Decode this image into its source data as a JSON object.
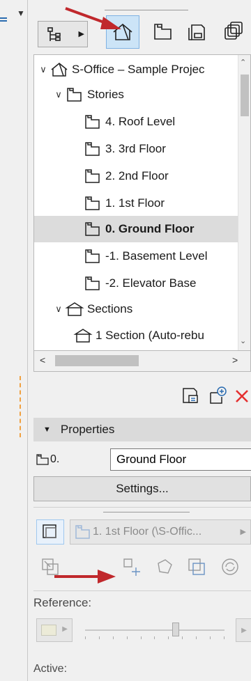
{
  "navigator": {
    "tree": {
      "project": "S-Office – Sample Projec",
      "stories_label": "Stories",
      "stories": [
        "4. Roof Level",
        "3. 3rd Floor",
        "2. 2nd Floor",
        "1. 1st Floor",
        "0. Ground Floor",
        "-1. Basement Level",
        "-2. Elevator Base"
      ],
      "selected_story": "0. Ground Floor",
      "sections_label": "Sections",
      "sections": [
        "1 Section (Auto-rebu"
      ]
    }
  },
  "properties": {
    "header": "Properties",
    "id_label": "0.",
    "name_value": "Ground Floor",
    "settings_label": "Settings..."
  },
  "trace": {
    "reference_view": "1. 1st Floor (\\S-Offic...",
    "reference_label": "Reference:",
    "slider_value": 0.65,
    "active_label": "Active:"
  },
  "colors": {
    "selection_bg": "#cce4f7",
    "arrow": "#c0282c",
    "delete_x": "#e53030",
    "icon_blue": "#2b6cb0"
  },
  "icons": [
    "project-map-icon",
    "view-map-icon",
    "layout-book-icon",
    "publisher-sets-icon",
    "story-icon",
    "section-icon",
    "project-icon",
    "settings-icon",
    "new-view-icon",
    "delete-icon"
  ]
}
